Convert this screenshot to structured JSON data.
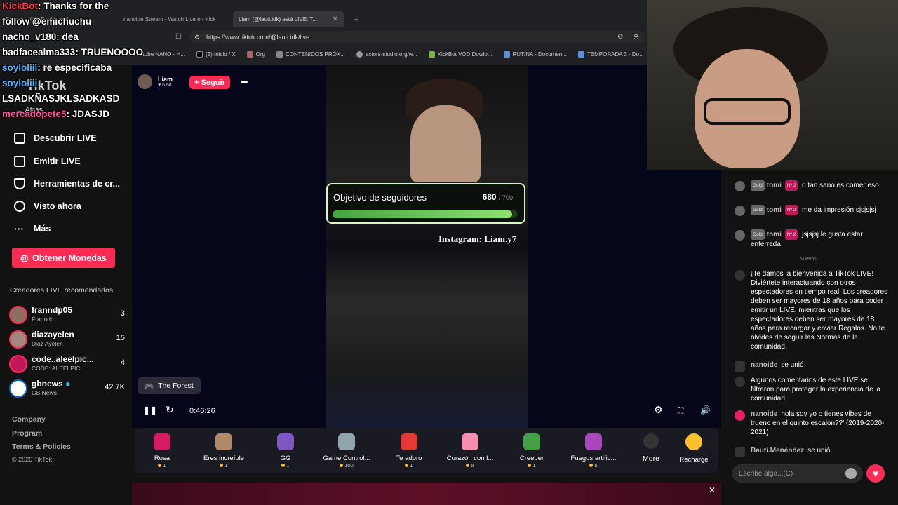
{
  "browser": {
    "tabs": [
      {
        "label": "Stream - Kick Dashboard",
        "active": false
      },
      {
        "label": "nanoide Stream - Watch Live on Kick",
        "active": false
      },
      {
        "label": "Liam (@lauti.idk) está LIVE: T...",
        "active": true
      }
    ],
    "url": "https://www.tiktok.com/@lauti.idk/live",
    "bookmarks": [
      "Youtube NANO - H...",
      "(2) Inicio / X",
      "Org",
      "CONTENIDOS PRÓX...",
      "actors-studio.org/w...",
      "KickBot VOD Dowlo...",
      "RUTINA - Documen...",
      "TEMPORADA 3 - Do..."
    ]
  },
  "overlay_chat": [
    {
      "user": "KickBot",
      "text": ": Thanks for the",
      "style": "kick"
    },
    {
      "user": "",
      "text": "follow @emichuchu",
      "style": ""
    },
    {
      "user": "nacho_v180",
      "text": ": dea",
      "style": ""
    },
    {
      "user": "badfacealma333",
      "text": ": TRUENOOOO",
      "style": ""
    },
    {
      "user": "soyloliii",
      "text": ": re especificaba",
      "style": "blue"
    },
    {
      "user": "soyloliii",
      "text": "",
      "style": "blue"
    },
    {
      "user": "",
      "text": "LSADKÑASJKLSADKASD",
      "style": ""
    },
    {
      "user": "mercadopete5",
      "text": ": JDASJD",
      "style": "pink"
    }
  ],
  "sidebar": {
    "logo": "TikTok",
    "back": "Atrás",
    "nav": [
      "Descubrir LIVE",
      "Emitir LIVE",
      "Herramientas de cr...",
      "Visto ahora",
      "Más"
    ],
    "coins_button": "Obtener Monedas",
    "recommended_title": "Creadores LIVE recomendados",
    "creators": [
      {
        "name": "franndp05",
        "sub": "Franndp",
        "count": "3"
      },
      {
        "name": "diazayelen",
        "sub": "Diaz Ayelen",
        "count": "15"
      },
      {
        "name": "code..aleelpic...",
        "sub": "CODE: ALEELPIC...",
        "count": "4"
      },
      {
        "name": "gbnews",
        "sub": "GB News",
        "count": "42.7K"
      }
    ],
    "footer": [
      "Company",
      "Program",
      "Terms & Policies",
      "© 2026 TikTok"
    ]
  },
  "stream": {
    "streamer_name": "Liam",
    "streamer_likes": "6.6K",
    "follow": "+ Seguir",
    "goal_label": "Objetivo de seguidores",
    "goal_current": "680",
    "goal_target": "700",
    "goal_fraction": 0.971,
    "instagram": "Instagram: Liam.y7",
    "game": "The Forest",
    "time": "0:46:26"
  },
  "gifts": [
    {
      "name": "Rosa",
      "price": "1",
      "color": "#d81b60"
    },
    {
      "name": "Eres increíble",
      "price": "1",
      "color": "#b08968"
    },
    {
      "name": "GG",
      "price": "1",
      "color": "#7e57c2"
    },
    {
      "name": "Game Control...",
      "price": "100",
      "color": "#90a4ae"
    },
    {
      "name": "Te adoro",
      "price": "1",
      "color": "#e53935"
    },
    {
      "name": "Corazón con l...",
      "price": "5",
      "color": "#f48fb1"
    },
    {
      "name": "Creeper",
      "price": "1",
      "color": "#43a047"
    },
    {
      "name": "Fuegos artific...",
      "price": "5",
      "color": "#ab47bc"
    }
  ],
  "more_label": "More",
  "recharge_label": "Recharge",
  "chat": {
    "messages": [
      {
        "badge": "Gold",
        "level": "Nº 2",
        "user": "tomi",
        "text": "q tan sano es comer eso"
      },
      {
        "badge": "Gold",
        "level": "Nº 2",
        "user": "tomi",
        "text": "me da impresión sjsjsjsj"
      },
      {
        "badge": "Gold",
        "level": "Nº 2",
        "user": "tomi",
        "text": "jsjsjsj le gusta estar enterrada"
      }
    ],
    "nuevos": "Nuevos",
    "welcome": "¡Te damos la bienvenida a TikTok LIVE! Diviértete interactuando con otros espectadores en tiempo real. Los creadores deben ser mayores de 18 años para poder emitir un LIVE, mientras que los espectadores deben ser mayores de 18 años para recargar y enviar Regalos. No te olvides de seguir las Normas de la comunidad.",
    "join1_user": "nanoide",
    "join_text": "se unió",
    "filtered": "Algunos comentarios de este LIVE se filtraron para proteger la experiencia de la comunidad.",
    "nano_user": "nanoide",
    "nano_text": "hola soy yo o tienes vibes de trueno en el quinto escalon??' (2019-2020-2021)",
    "join2_user": "Bauti.Menéndez",
    "input_placeholder": "Escribe algo...(C)"
  }
}
